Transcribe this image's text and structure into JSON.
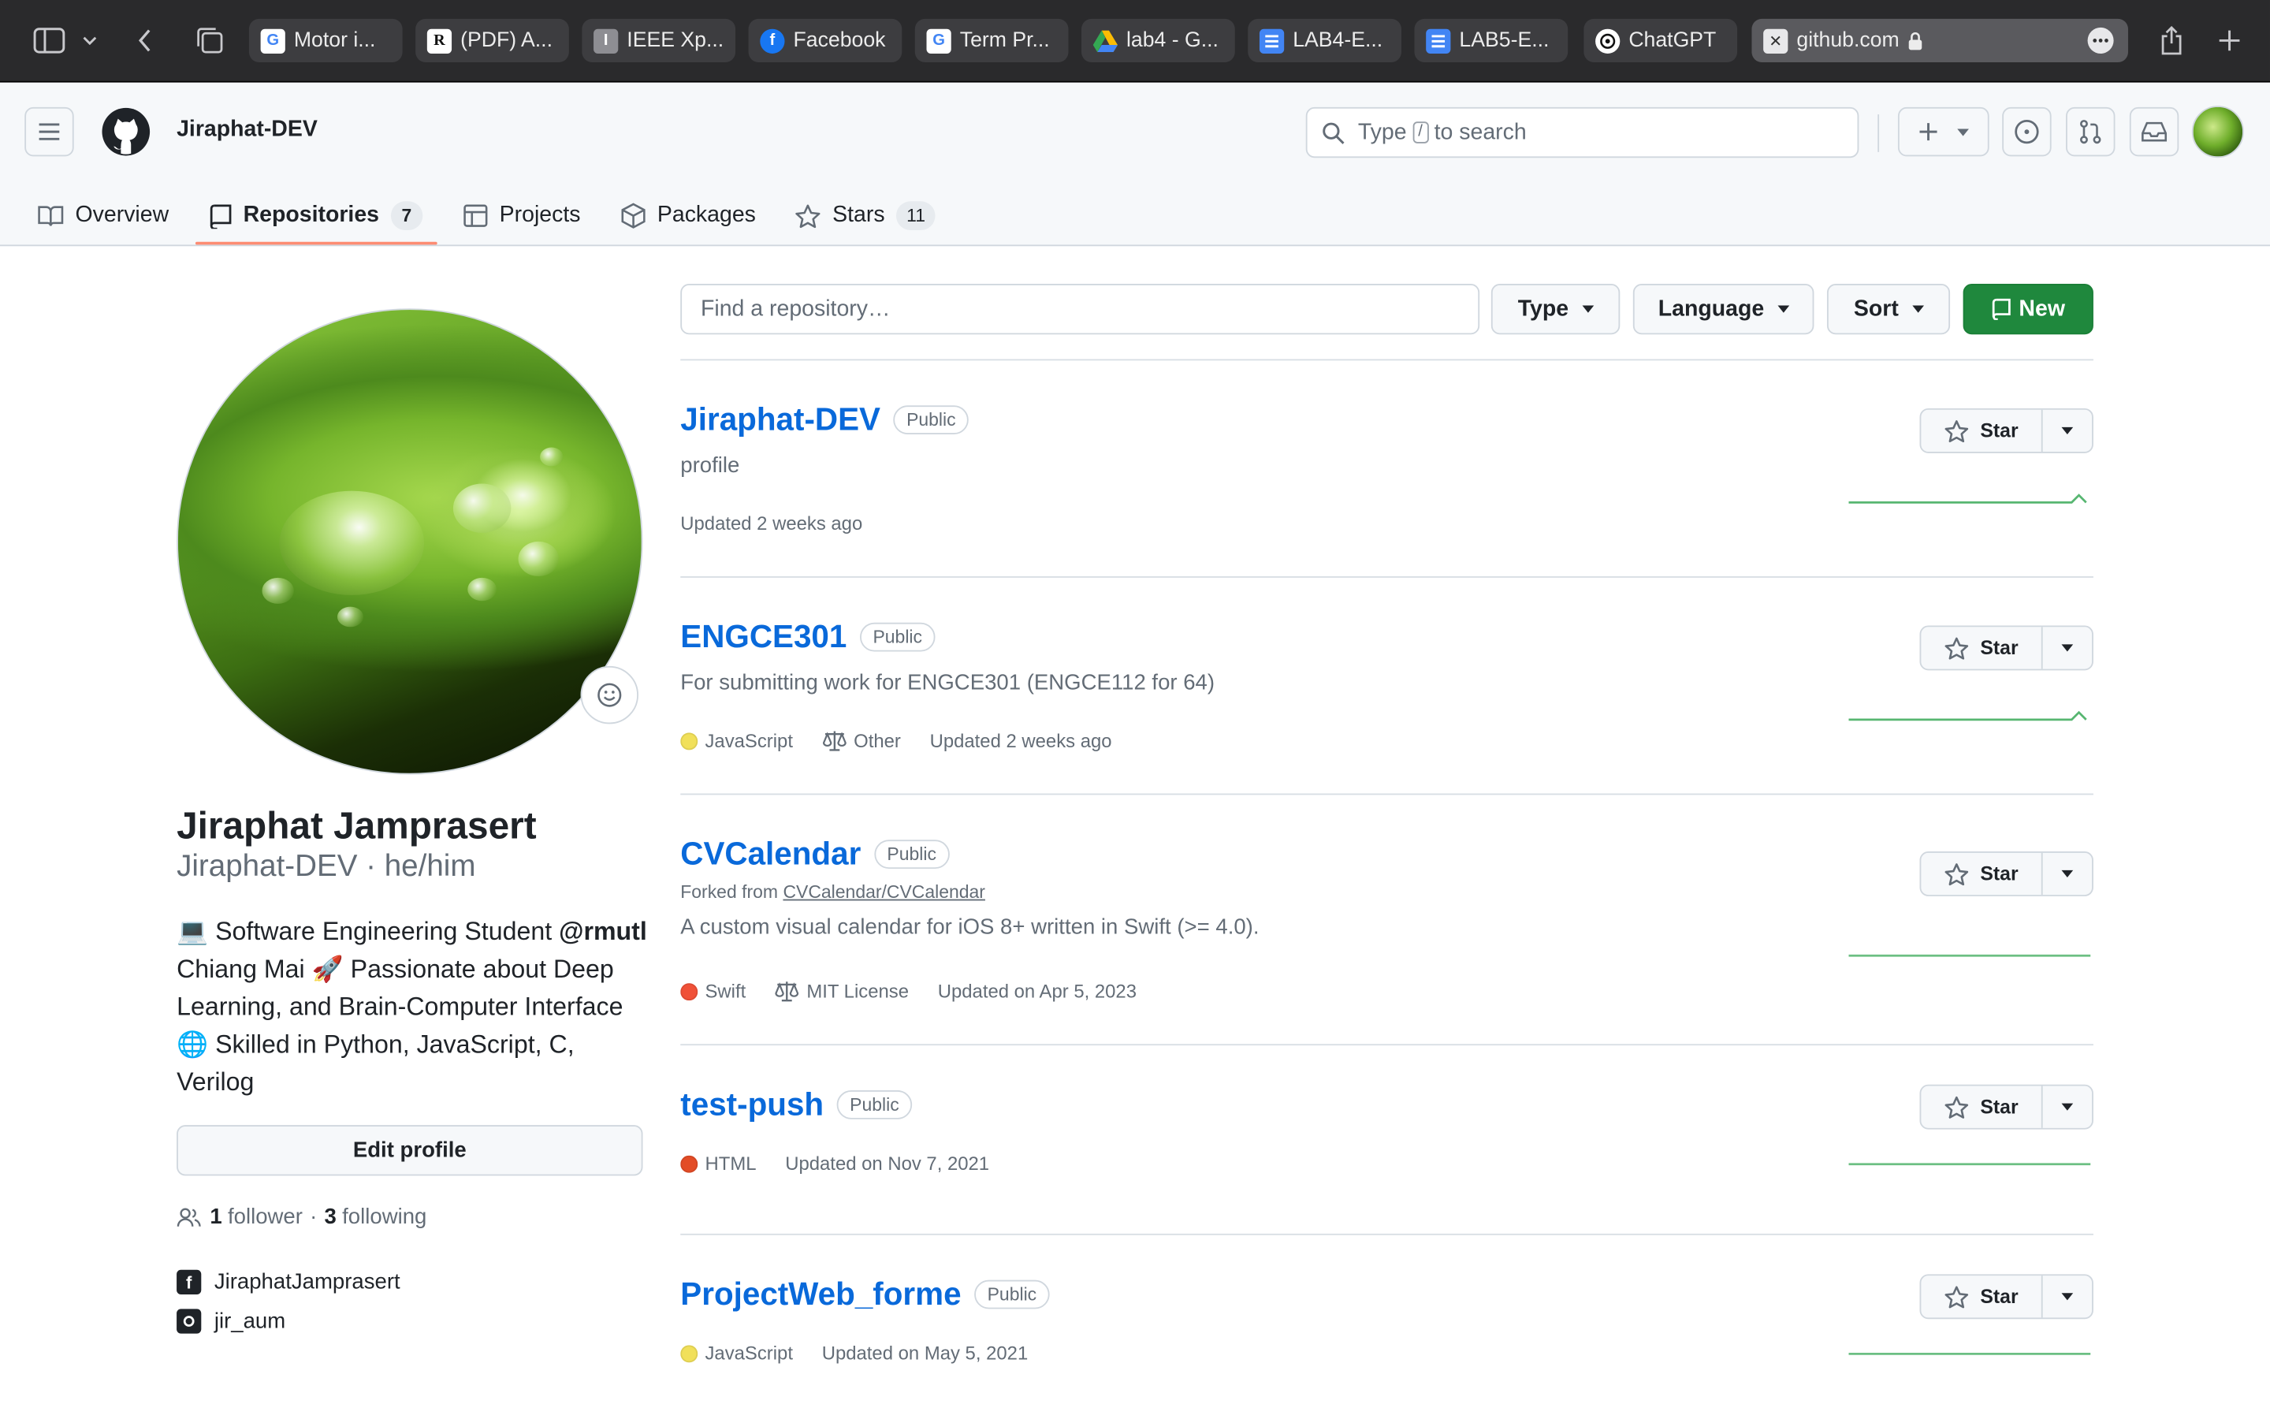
{
  "browser": {
    "tabs": [
      {
        "label": "Motor i...",
        "favicon": "google"
      },
      {
        "label": "(PDF) A...",
        "favicon": "researchgate"
      },
      {
        "label": "IEEE Xp...",
        "favicon": "ieee"
      },
      {
        "label": "Facebook",
        "favicon": "facebook"
      },
      {
        "label": "Term Pr...",
        "favicon": "google"
      },
      {
        "label": "lab4 - G...",
        "favicon": "google-drive"
      },
      {
        "label": "LAB4-E...",
        "favicon": "google-docs"
      },
      {
        "label": "LAB5-E...",
        "favicon": "google-docs"
      },
      {
        "label": "ChatGPT",
        "favicon": "chatgpt"
      }
    ],
    "active_tab": {
      "label": "github.com",
      "favicon": "close-x"
    }
  },
  "header": {
    "username": "Jiraphat-DEV",
    "search": {
      "before": "Type",
      "key": "/",
      "after": "to search"
    }
  },
  "nav": {
    "overview": "Overview",
    "repositories": "Repositories",
    "repositories_count": "7",
    "projects": "Projects",
    "packages": "Packages",
    "stars": "Stars",
    "stars_count": "11"
  },
  "profile": {
    "full_name": "Jiraphat Jamprasert",
    "login_pronouns": "Jiraphat-DEV · he/him",
    "bio": {
      "emoji_laptop": "💻",
      "part1": "Software Engineering Student",
      "mention": "@rmutl",
      "part2": "Chiang Mai",
      "emoji_rocket": "🚀",
      "part3": "Passionate about Deep Learning, and Brain-Computer Interface",
      "emoji_globe": "🌐",
      "part4": "Skilled in Python, JavaScript, C, Verilog"
    },
    "edit_label": "Edit profile",
    "followers": "1",
    "followers_label": "follower",
    "sep": "·",
    "following": "3",
    "following_label": "following",
    "facebook": "JiraphatJamprasert",
    "instagram": "jir_aum"
  },
  "filters": {
    "find_placeholder": "Find a repository…",
    "type": "Type",
    "language": "Language",
    "sort": "Sort",
    "new": "New"
  },
  "repos": [
    {
      "name": "Jiraphat-DEV",
      "visibility": "Public",
      "description": "profile",
      "updated": "Updated 2 weeks ago"
    },
    {
      "name": "ENGCE301",
      "visibility": "Public",
      "description": "For submitting work for ENGCE301 (ENGCE112 for 64)",
      "language": "JavaScript",
      "language_color": "#f1e05a",
      "license": "Other",
      "updated": "Updated 2 weeks ago"
    },
    {
      "name": "CVCalendar",
      "visibility": "Public",
      "forked_prefix": "Forked from",
      "forked_from": "CVCalendar/CVCalendar",
      "description": "A custom visual calendar for iOS 8+ written in Swift (>= 4.0).",
      "language": "Swift",
      "language_color": "#F05138",
      "license": "MIT License",
      "updated": "Updated on Apr 5, 2023"
    },
    {
      "name": "test-push",
      "visibility": "Public",
      "language": "HTML",
      "language_color": "#e34c26",
      "updated": "Updated on Nov 7, 2021"
    },
    {
      "name": "ProjectWeb_forme",
      "visibility": "Public",
      "language": "JavaScript",
      "language_color": "#f1e05a",
      "updated": "Updated on May 5, 2021"
    }
  ],
  "star_label": "Star",
  "colors": {
    "link": "#0969da",
    "primary_button": "#1f883d",
    "tab_underline": "#fd8c73",
    "sparkline": "#2da44e"
  }
}
